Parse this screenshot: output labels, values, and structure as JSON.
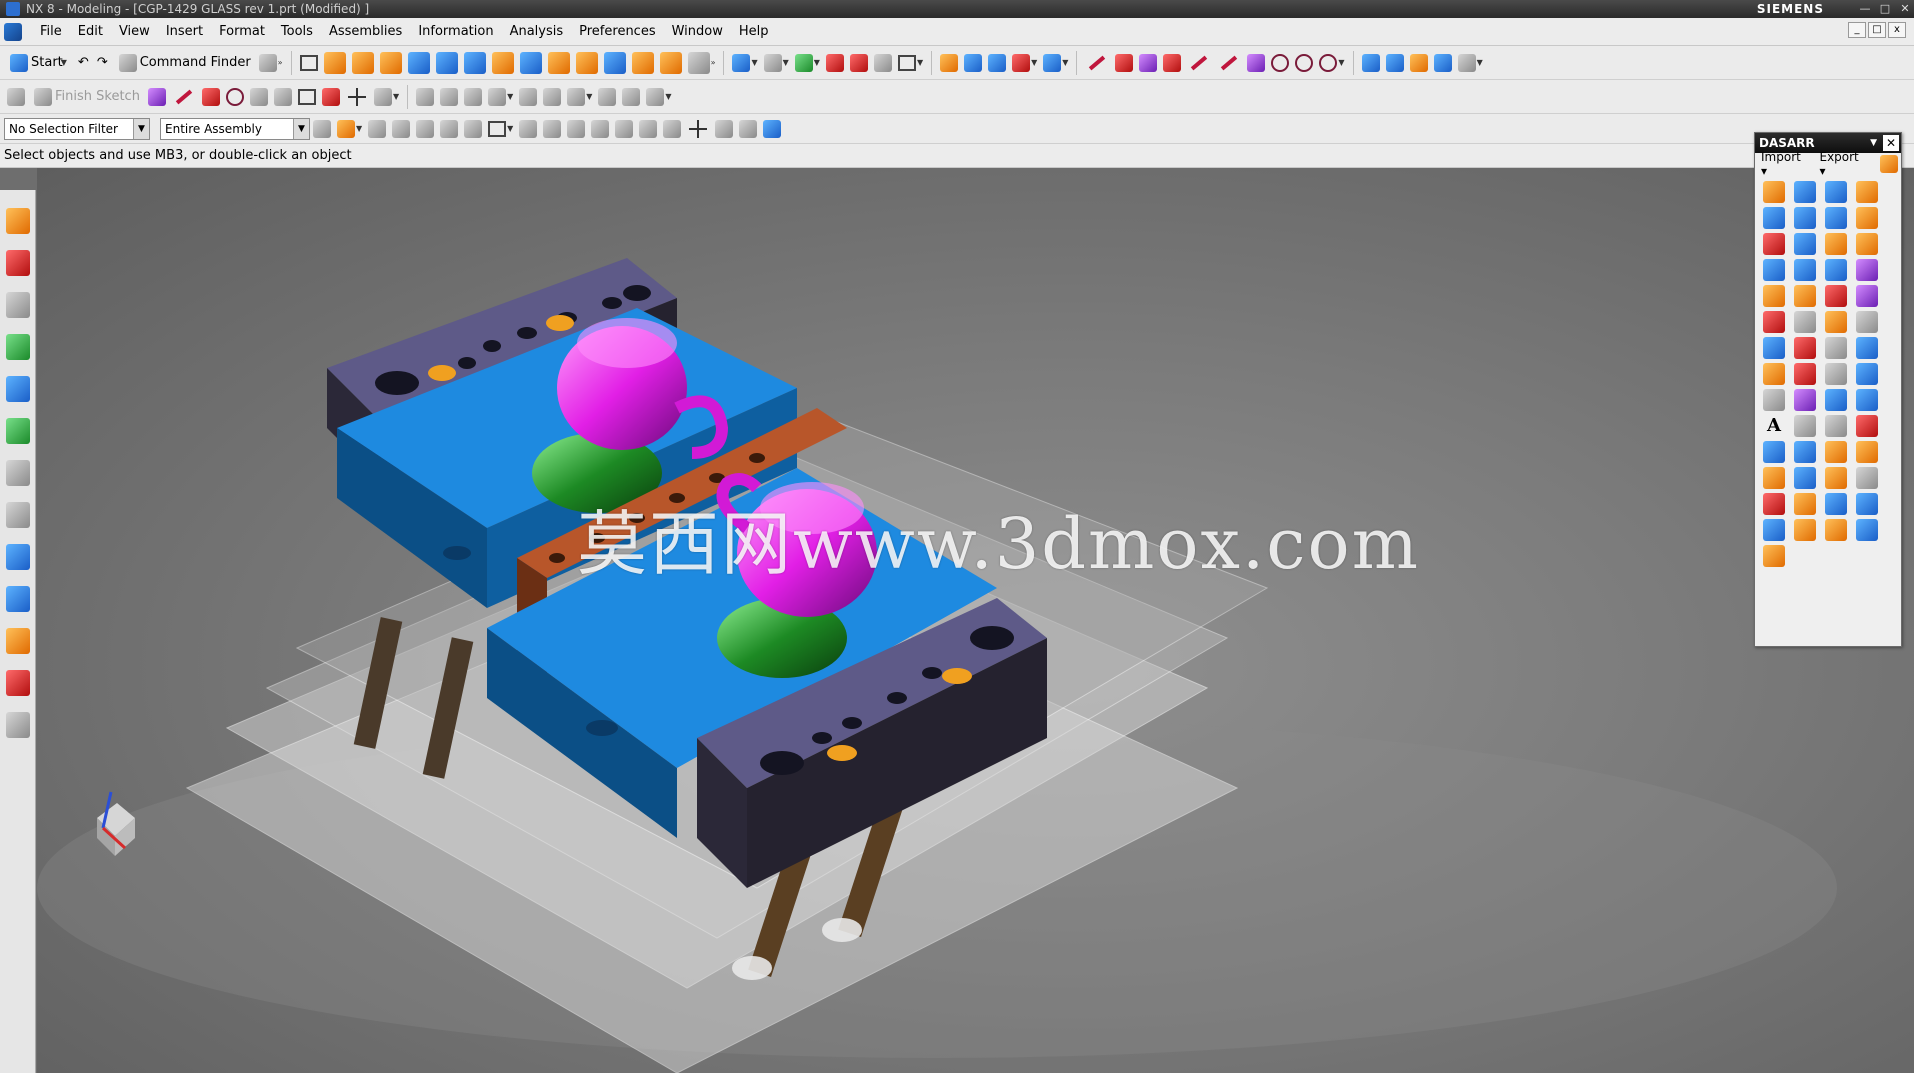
{
  "window": {
    "title": "NX 8 - Modeling - [CGP-1429 GLASS rev 1.prt (Modified) ]",
    "brand": "SIEMENS"
  },
  "menu": {
    "items": [
      "File",
      "Edit",
      "View",
      "Insert",
      "Format",
      "Tools",
      "Assemblies",
      "Information",
      "Analysis",
      "Preferences",
      "Window",
      "Help"
    ]
  },
  "toolbar": {
    "start_label": "Start",
    "command_finder_label": "Command Finder",
    "finish_sketch_label": "Finish Sketch"
  },
  "selection": {
    "filter_value": "No Selection Filter",
    "scope_value": "Entire Assembly"
  },
  "status": {
    "prompt": "Select objects and use MB3, or double-click an object"
  },
  "panel": {
    "title": "DASARR",
    "import_label": "Import",
    "export_label": "Export"
  },
  "viewport": {
    "watermark": "莫西网www.3dmox.com"
  },
  "colors": {
    "cavity_plate": "#1e8ae0",
    "clamp_plate": "#5e5a88",
    "insert_cup": "#e21fe6",
    "core": "#1d8a24",
    "slider": "#b8562a"
  }
}
